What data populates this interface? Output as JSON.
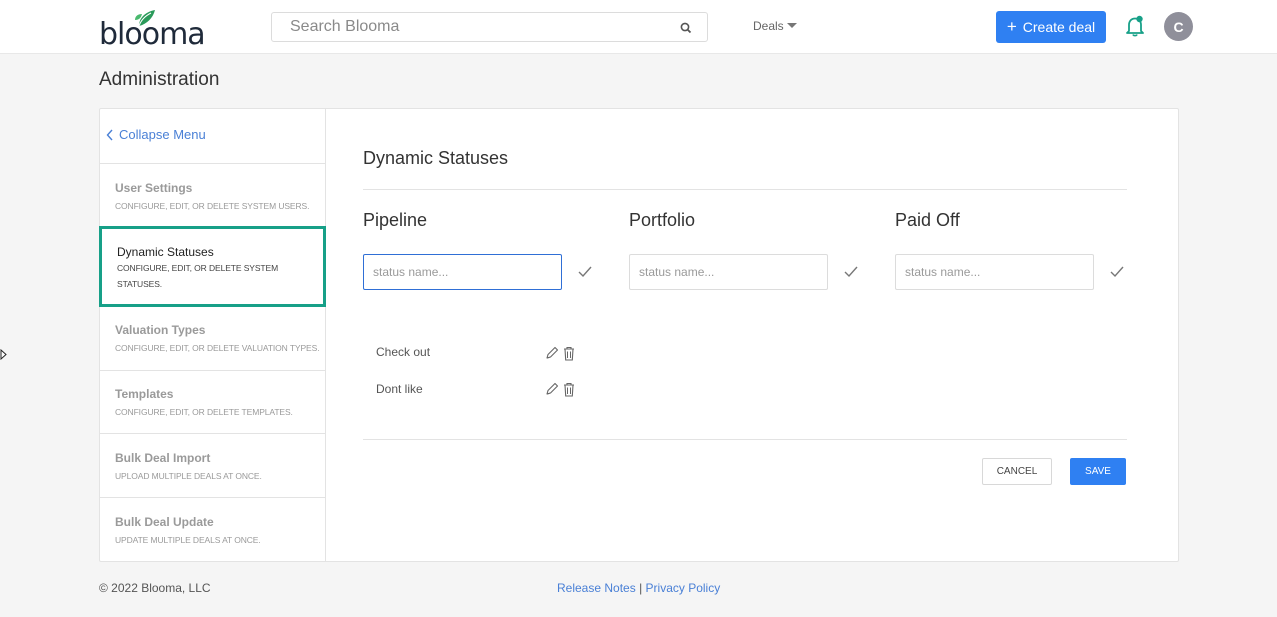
{
  "header": {
    "logo_text": "blooma",
    "search_placeholder": "Search Blooma",
    "deals_menu_label": "Deals",
    "create_button_label": "Create deal",
    "avatar_initial": "C",
    "accent_color": "#2f80f2",
    "bell_color": "#17a088"
  },
  "page": {
    "title": "Administration"
  },
  "sidebar": {
    "collapse_label": "Collapse Menu",
    "items": [
      {
        "title": "User Settings",
        "description": "CONFIGURE, EDIT, OR DELETE SYSTEM USERS."
      },
      {
        "title": "Dynamic Statuses",
        "description": "CONFIGURE, EDIT, OR DELETE SYSTEM STATUSES."
      },
      {
        "title": "Valuation Types",
        "description": "CONFIGURE, EDIT, OR DELETE VALUATION TYPES."
      },
      {
        "title": "Templates",
        "description": "CONFIGURE, EDIT, OR DELETE TEMPLATES."
      },
      {
        "title": "Bulk Deal Import",
        "description": "UPLOAD MULTIPLE DEALS AT ONCE."
      },
      {
        "title": "Bulk Deal Update",
        "description": "UPDATE MULTIPLE DEALS AT ONCE."
      }
    ],
    "active_color": "#17a088"
  },
  "main": {
    "section_title": "Dynamic Statuses",
    "columns": [
      {
        "heading": "Pipeline",
        "placeholder": "status name..."
      },
      {
        "heading": "Portfolio",
        "placeholder": "status name..."
      },
      {
        "heading": "Paid Off",
        "placeholder": "status name..."
      }
    ],
    "pipeline_statuses": [
      "Check out",
      "Dont like"
    ],
    "cancel_label": "CANCEL",
    "save_label": "SAVE"
  },
  "footer": {
    "copyright": "© 2022 Blooma, LLC",
    "release_notes": "Release Notes",
    "separator": "|",
    "privacy_policy": "Privacy Policy"
  }
}
